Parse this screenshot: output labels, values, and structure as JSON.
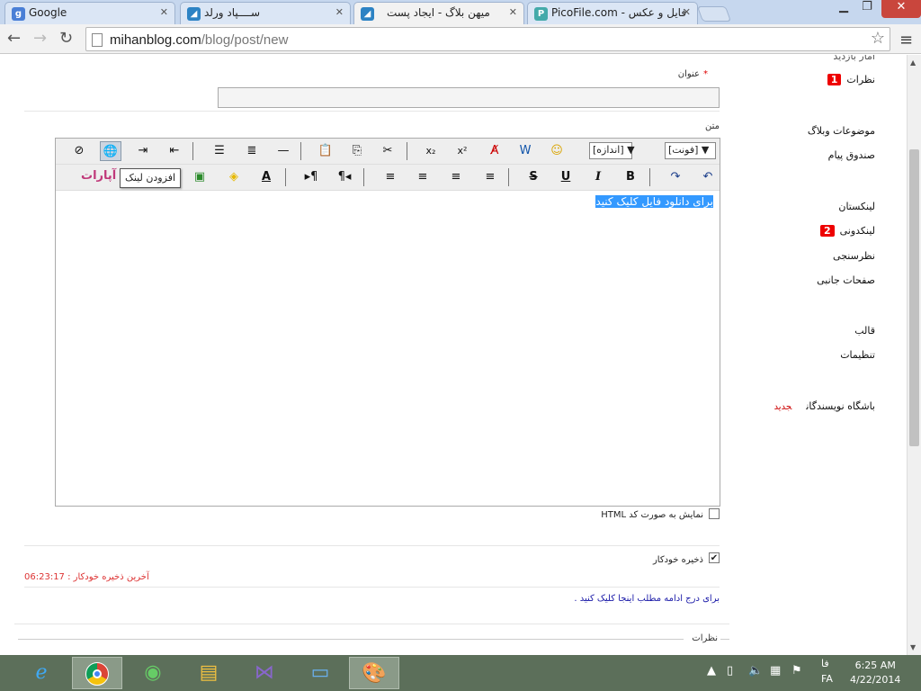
{
  "browser": {
    "tabs": [
      {
        "label": "Google",
        "icon": "google-icon",
        "color": "#4a7fd6"
      },
      {
        "label": "سـ‌ـــپاد ورلد",
        "icon": "mihanblog-icon",
        "color": "#2d83c4"
      },
      {
        "label": "میهن بلاگ - ایجاد پست",
        "icon": "mihanblog-icon",
        "color": "#2d83c4"
      },
      {
        "label": "PicoFile.com - فایل و عکس",
        "icon": "picofile-icon",
        "color": "#4aa"
      }
    ],
    "url_host": "mihanblog.com",
    "url_path": "/blog/post/new"
  },
  "sidebar": {
    "top_partial": "آمار بازدید",
    "items": [
      {
        "label": "نظرات",
        "badge": "1"
      },
      {
        "label": "موضوعات وبلاگ"
      },
      {
        "label": "صندوق پیام"
      },
      {
        "label": "لینکستان"
      },
      {
        "label": "لینکدونی",
        "badge": "2"
      },
      {
        "label": "نظرسنجی"
      },
      {
        "label": "صفحات جانبی"
      },
      {
        "label": "قالب"
      },
      {
        "label": "تنظیمات"
      },
      {
        "label": "باشگاه نویسندگان",
        "tag": "جدید"
      }
    ]
  },
  "form": {
    "required_mark": "*",
    "title_label": "عنوان",
    "title_value": "",
    "body_label": "متن",
    "font_dropdown": "[فونت]",
    "size_dropdown": "[اندازه]",
    "tooltip": "افزودن لینک",
    "aparat_label": "آپارات",
    "editor_content": "برای دانلود فایل کلیک کنید",
    "show_html_label": "نمایش به صورت کد HTML",
    "autosave_label": "ذخیره خودکار",
    "last_autosave": "آخرین ذخیره خودکار : 06:23:17",
    "read_more_link": "برای درج ادامه مطلب اینجا کلیک کنید .",
    "comments_label": "نظرات"
  },
  "taskbar": {
    "language_short": "فا",
    "language": "FA",
    "time": "6:25 AM",
    "date": "4/22/2014"
  }
}
